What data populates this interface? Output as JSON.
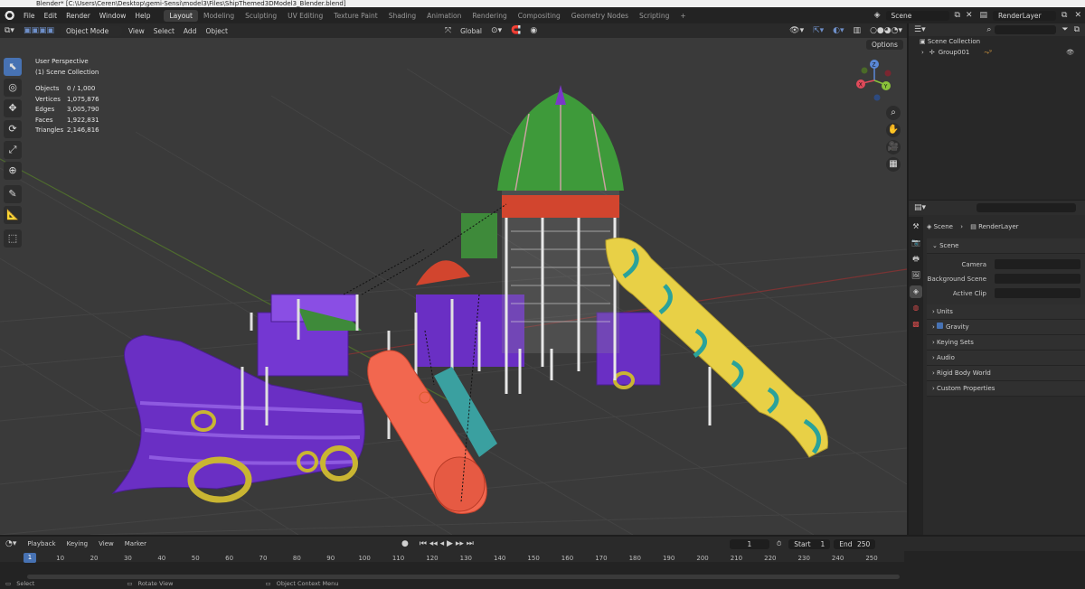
{
  "window": {
    "title": "Blender* [C:\\Users\\Ceren\\Desktop\\gemi-Sensi\\model3\\Files\\ShipThemed3DModel3_Blender.blend]"
  },
  "menu": [
    "File",
    "Edit",
    "Render",
    "Window",
    "Help"
  ],
  "workspaces": [
    "Layout",
    "Modeling",
    "Sculpting",
    "UV Editing",
    "Texture Paint",
    "Shading",
    "Animation",
    "Rendering",
    "Compositing",
    "Geometry Nodes",
    "Scripting",
    "+"
  ],
  "scene_selector": "Scene",
  "layer_selector": "RenderLayer",
  "viewport": {
    "mode": "Object Mode",
    "menus": [
      "View",
      "Select",
      "Add",
      "Object"
    ],
    "transform_orientation": "Global",
    "options_label": "Options",
    "perspective": "User Perspective",
    "collection": "(1) Scene Collection",
    "stats": [
      {
        "label": "Objects",
        "value": "0 / 1,000"
      },
      {
        "label": "Vertices",
        "value": "1,075,876"
      },
      {
        "label": "Edges",
        "value": "3,005,790"
      },
      {
        "label": "Faces",
        "value": "1,922,831"
      },
      {
        "label": "Triangles",
        "value": "2,146,816"
      }
    ],
    "gizmo_axes": {
      "x": "X",
      "y": "Y",
      "z": "Z"
    }
  },
  "outliner": {
    "root": "Scene Collection",
    "items": [
      {
        "label": "Group001"
      }
    ]
  },
  "properties": {
    "breadcrumb_scene": "Scene",
    "breadcrumb_layer": "RenderLayer",
    "section_title": "Scene",
    "fields": [
      {
        "label": "Camera"
      },
      {
        "label": "Background Scene"
      },
      {
        "label": "Active Clip"
      }
    ],
    "panels": [
      "Units",
      "Gravity",
      "Keying Sets",
      "Audio",
      "Rigid Body World",
      "Custom Properties"
    ]
  },
  "timeline": {
    "menus": [
      "Playback",
      "Keying",
      "View",
      "Marker"
    ],
    "current_frame": "1",
    "start_label": "Start",
    "start": "1",
    "end_label": "End",
    "end": "250",
    "ticks": [
      "1",
      "10",
      "20",
      "30",
      "40",
      "50",
      "60",
      "70",
      "80",
      "90",
      "100",
      "110",
      "120",
      "130",
      "140",
      "150",
      "160",
      "170",
      "180",
      "190",
      "200",
      "210",
      "220",
      "230",
      "240",
      "250"
    ]
  },
  "status_bar": [
    "Select",
    "Rotate View",
    "Object Context Menu"
  ]
}
